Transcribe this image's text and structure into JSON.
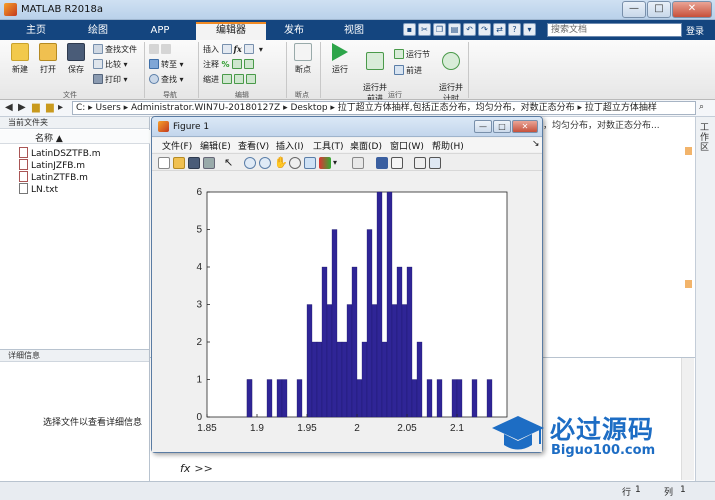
{
  "window": {
    "title": "MATLAB R2018a",
    "min": "—",
    "max": "□",
    "close": "✕"
  },
  "tabs": [
    {
      "label": "主页"
    },
    {
      "label": "绘图"
    },
    {
      "label": "APP"
    },
    {
      "label": "编辑器"
    },
    {
      "label": "发布"
    },
    {
      "label": "视图"
    }
  ],
  "search": {
    "placeholder": "搜索文档"
  },
  "login": "登录",
  "ribbon": {
    "new": "新建",
    "open": "打开",
    "save": "保存",
    "find_files": "查找文件",
    "compare": "比较",
    "print": "打印",
    "goto": "转至",
    "find": "查找",
    "insert": "插入",
    "comment": "注释",
    "indent": "缩进",
    "breakpoints": "断点",
    "run": "运行",
    "run_advance": "运行并\n前进",
    "run_section": "运行节",
    "advance": "前进",
    "run_time": "运行并\n计时",
    "groups": {
      "file": "文件",
      "navigate": "导航",
      "edit": "编辑",
      "breakpoints": "断点",
      "run": "运行"
    }
  },
  "address": {
    "path": "C: ▸ Users ▸ Administrator.WIN7U-20180127Z ▸ Desktop ▸ 拉丁超立方体抽样,包括正态分布，均匀分布，对数正态分布 ▸ 拉丁超立方体抽样"
  },
  "folder_panel": {
    "title": "当前文件夹",
    "column_name": "名称 ▲",
    "files": [
      "LatinDSZTFB.m",
      "LatinJZFB.m",
      "LatinZTFB.m",
      "LN.txt"
    ]
  },
  "details_panel": {
    "title": "详细信息",
    "message": "选择文件以查看详细信息"
  },
  "editor_tab_text": "，均匀分布，对数正态分布...",
  "workspace_label": "工作区",
  "command": {
    "prompt_fx": "fx",
    "prompt_chevron": ">>"
  },
  "status": {
    "row_label": "行",
    "row_value": "1",
    "col_label": "列",
    "col_value": "1"
  },
  "figure": {
    "title": "Figure 1",
    "menu": [
      "文件(F)",
      "编辑(E)",
      "查看(V)",
      "插入(I)",
      "工具(T)",
      "桌面(D)",
      "窗口(W)",
      "帮助(H)"
    ]
  },
  "watermark": {
    "cn": "必过源码",
    "en": "Biguo100.com"
  },
  "chart_data": {
    "type": "bar",
    "title": "",
    "xlabel": "",
    "ylabel": "",
    "xlim": [
      1.85,
      2.15
    ],
    "ylim": [
      0,
      6
    ],
    "xticks": [
      1.85,
      1.9,
      1.95,
      2,
      2.05,
      2.1
    ],
    "yticks": [
      0,
      1,
      2,
      3,
      4,
      5,
      6
    ],
    "bar_color": "#2f2596",
    "x": [
      1.8925,
      1.8925,
      1.9075,
      1.9125,
      1.9225,
      1.9275,
      1.9425,
      1.9525,
      1.9575,
      1.9625,
      1.9675,
      1.9725,
      1.9775,
      1.9825,
      1.9875,
      1.9925,
      1.9975,
      2.0025,
      2.0075,
      2.0125,
      2.0175,
      2.0225,
      2.0275,
      2.0325,
      2.0375,
      2.0425,
      2.0475,
      2.0525,
      2.0575,
      2.0625,
      2.0725,
      2.0825,
      2.0975,
      2.1025,
      2.1175,
      2.1325
    ],
    "values": [
      1,
      1,
      0,
      1,
      1,
      1,
      1,
      3,
      2,
      2,
      4,
      3,
      5,
      2,
      2,
      3,
      4,
      1,
      2,
      5,
      3,
      6,
      2,
      6,
      3,
      4,
      3,
      4,
      1,
      2,
      1,
      1,
      1,
      1,
      1,
      1
    ]
  }
}
